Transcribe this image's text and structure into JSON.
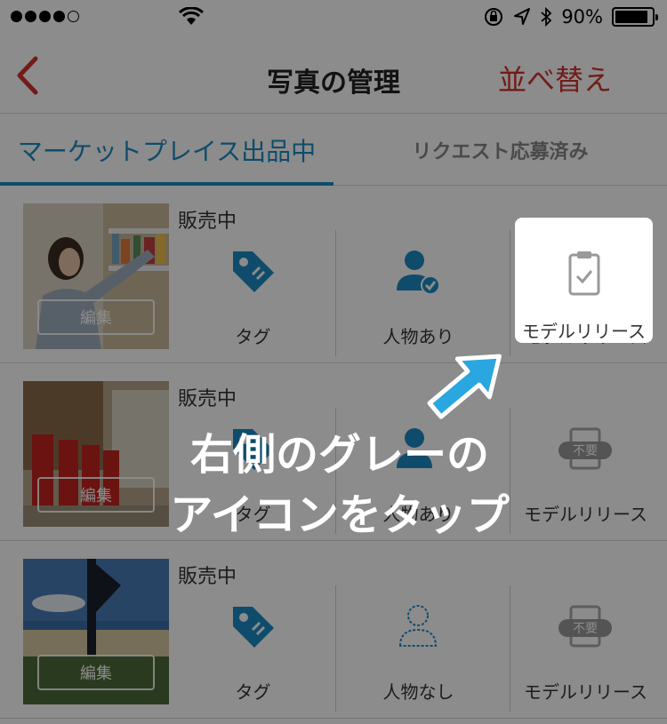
{
  "status_bar": {
    "battery_percent": "90%",
    "battery_level": 0.9
  },
  "nav": {
    "title": "写真の管理",
    "sort_label": "並べ替え"
  },
  "tabs": [
    {
      "label": "マーケットプレイス出品中",
      "active": true
    },
    {
      "label": "リクエスト応募済み",
      "active": false
    }
  ],
  "rows": [
    {
      "status": "販売中",
      "edit_label": "編集",
      "tag_label": "タグ",
      "person_label": "人物あり",
      "release_label": "モデルリリース"
    },
    {
      "status": "販売中",
      "edit_label": "編集",
      "tag_label": "タグ",
      "person_label": "人物あり",
      "release_label": "モデルリリース",
      "release_badge": "不要"
    },
    {
      "status": "販売中",
      "edit_label": "編集",
      "tag_label": "タグ",
      "person_label": "人物なし",
      "release_label": "モデルリリース",
      "release_badge": "不要"
    }
  ],
  "overlay": {
    "highlight_label": "モデルリリース",
    "instruction_line1": "右側のグレーの",
    "instruction_line2": "アイコンをタップ"
  },
  "colors": {
    "accent": "#1d8bc4",
    "sort": "#d0342c",
    "icon_blue": "#1d8bc4",
    "icon_gray": "#aaaaaa",
    "arrow": "#2aa6e0"
  }
}
